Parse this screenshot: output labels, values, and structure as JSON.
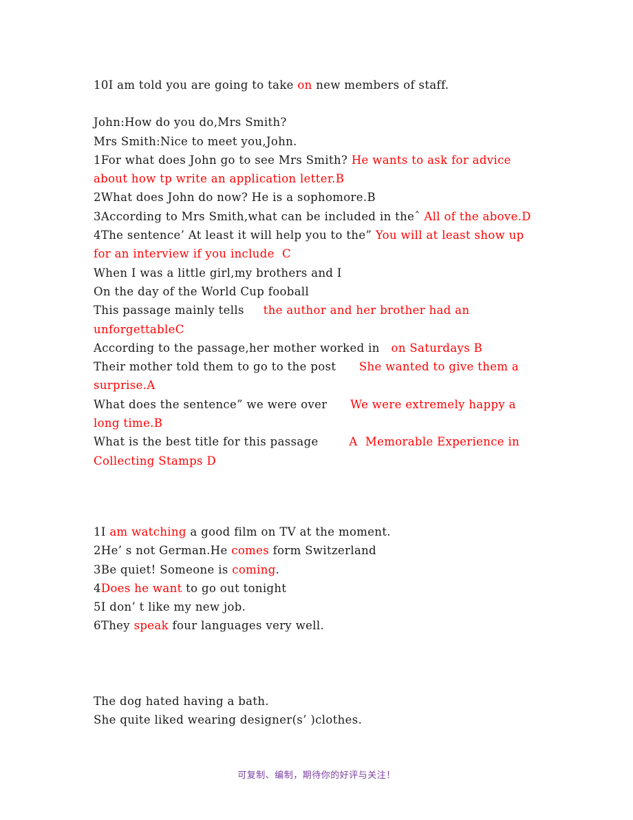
{
  "document": {
    "background_color": "#ffffff",
    "text_color": "#1a1a1a",
    "answer_color": "#ff0000",
    "footer_color": "#7b3fa0"
  },
  "section_1": {
    "lines": [
      {
        "parts": [
          {
            "text": "10I am told you are going to take ",
            "color": "black"
          },
          {
            "text": "on",
            "color": "red"
          },
          {
            "text": " new members of staff.",
            "color": "black"
          }
        ]
      }
    ]
  },
  "section_2": {
    "lines": [
      {
        "parts": [
          {
            "text": "John:How do you do,Mrs Smith?",
            "color": "black"
          }
        ]
      },
      {
        "parts": [
          {
            "text": "Mrs Smith:Nice to meet you,John.",
            "color": "black"
          }
        ]
      },
      {
        "parts": [
          {
            "text": "1For what does John go to see Mrs Smith? ",
            "color": "black"
          },
          {
            "text": "He wants to ask for advice about how tp write an application letter.B",
            "color": "red"
          }
        ]
      },
      {
        "parts": [
          {
            "text": "2What does John do now? He is a sophomore.B",
            "color": "black"
          }
        ]
      },
      {
        "parts": [
          {
            "text": "3According to Mrs Smith,what can be included in theˆ ",
            "color": "black"
          },
          {
            "text": "All of the above.D",
            "color": "red"
          }
        ]
      },
      {
        "parts": [
          {
            "text": "4The sentence’ At least it will help you to the” ",
            "color": "black"
          },
          {
            "text": "You will at least show up for an interview if you include  C",
            "color": "red"
          }
        ]
      },
      {
        "parts": [
          {
            "text": "When I was a little girl,my brothers and I",
            "color": "black"
          }
        ]
      },
      {
        "parts": [
          {
            "text": "On the day of the World Cup fooball",
            "color": "black"
          }
        ]
      },
      {
        "parts": [
          {
            "text": "This passage mainly tells     ",
            "color": "black"
          },
          {
            "text": "the author and her brother had an unforgettableC",
            "color": "red"
          }
        ]
      },
      {
        "parts": [
          {
            "text": "According to the passage,her mother worked in   ",
            "color": "black"
          },
          {
            "text": "on Saturdays B",
            "color": "red"
          }
        ]
      },
      {
        "parts": [
          {
            "text": "Their mother told them to go to the post      ",
            "color": "black"
          },
          {
            "text": "She wanted to give them a surprise.A",
            "color": "red"
          }
        ]
      },
      {
        "parts": [
          {
            "text": "What does the sentence” we were over      ",
            "color": "black"
          },
          {
            "text": "We were extremely happy a long time.B",
            "color": "red"
          }
        ]
      },
      {
        "parts": [
          {
            "text": "What is the best title for this passage        ",
            "color": "black"
          },
          {
            "text": "A  Memorable Experience in Collecting Stamps D",
            "color": "red"
          }
        ]
      }
    ]
  },
  "section_3": {
    "lines": [
      {
        "parts": [
          {
            "text": "1I ",
            "color": "black"
          },
          {
            "text": "am watching",
            "color": "red"
          },
          {
            "text": " a good film on TV at the moment.",
            "color": "black"
          }
        ]
      },
      {
        "parts": [
          {
            "text": "2He’ s not German.He ",
            "color": "black"
          },
          {
            "text": "comes",
            "color": "red"
          },
          {
            "text": " form Switzerland",
            "color": "black"
          }
        ]
      },
      {
        "parts": [
          {
            "text": "3Be quiet! Someone is ",
            "color": "black"
          },
          {
            "text": "coming",
            "color": "red"
          },
          {
            "text": ".",
            "color": "black"
          }
        ]
      },
      {
        "parts": [
          {
            "text": "4",
            "color": "black"
          },
          {
            "text": "Does he want",
            "color": "red"
          },
          {
            "text": " to go out tonight",
            "color": "black"
          }
        ]
      },
      {
        "parts": [
          {
            "text": "5I don’ t like my new job.",
            "color": "black"
          }
        ]
      },
      {
        "parts": [
          {
            "text": "6They ",
            "color": "black"
          },
          {
            "text": "speak",
            "color": "red"
          },
          {
            "text": " four languages very well.",
            "color": "black"
          }
        ]
      }
    ]
  },
  "section_4": {
    "lines": [
      {
        "parts": [
          {
            "text": "The dog hated having a bath.",
            "color": "black"
          }
        ]
      },
      {
        "parts": [
          {
            "text": "She quite liked wearing designer(s’ )clothes.",
            "color": "black"
          }
        ]
      }
    ]
  },
  "footer": {
    "text": "可复制、编制，期待你的好评与关注！"
  }
}
